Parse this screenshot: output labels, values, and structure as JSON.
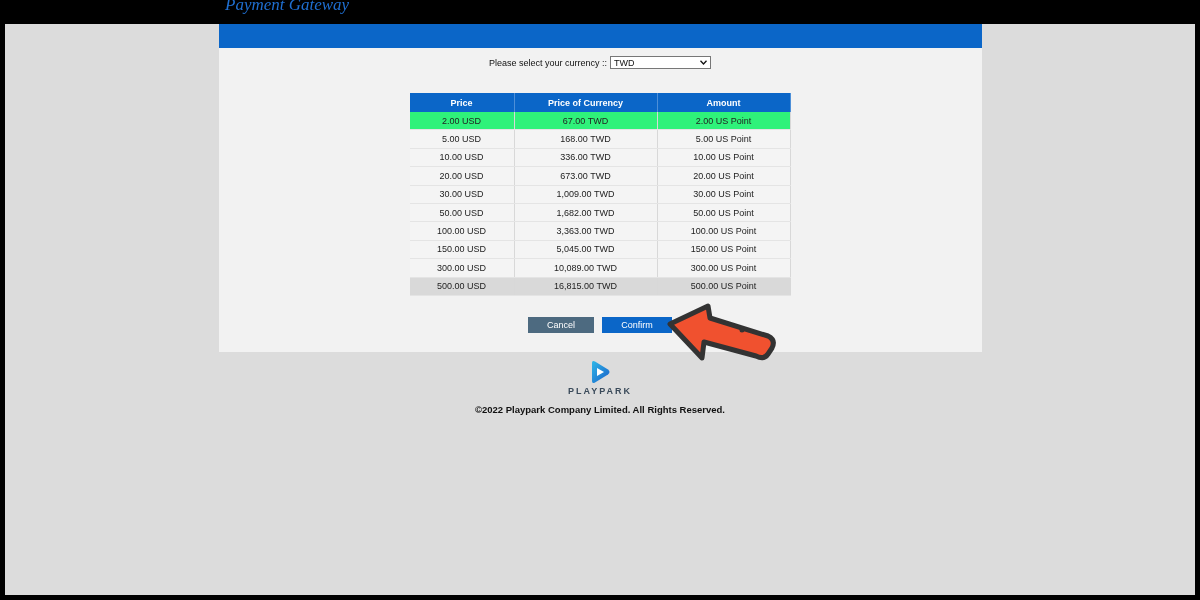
{
  "page_title": "Payment Gateway",
  "currency_select": {
    "label": "Please select your currency ::",
    "value": "TWD"
  },
  "table": {
    "columns": [
      "Price",
      "Price of Currency",
      "Amount"
    ],
    "rows": [
      {
        "cells": [
          "2.00 USD",
          "67.00 TWD",
          "2.00 US Point"
        ],
        "selected": true,
        "hovered": false
      },
      {
        "cells": [
          "5.00 USD",
          "168.00 TWD",
          "5.00 US Point"
        ],
        "selected": false,
        "hovered": false
      },
      {
        "cells": [
          "10.00 USD",
          "336.00 TWD",
          "10.00 US Point"
        ],
        "selected": false,
        "hovered": false
      },
      {
        "cells": [
          "20.00 USD",
          "673.00 TWD",
          "20.00 US Point"
        ],
        "selected": false,
        "hovered": false
      },
      {
        "cells": [
          "30.00 USD",
          "1,009.00 TWD",
          "30.00 US Point"
        ],
        "selected": false,
        "hovered": false
      },
      {
        "cells": [
          "50.00 USD",
          "1,682.00 TWD",
          "50.00 US Point"
        ],
        "selected": false,
        "hovered": false
      },
      {
        "cells": [
          "100.00 USD",
          "3,363.00 TWD",
          "100.00 US Point"
        ],
        "selected": false,
        "hovered": false
      },
      {
        "cells": [
          "150.00 USD",
          "5,045.00 TWD",
          "150.00 US Point"
        ],
        "selected": false,
        "hovered": false
      },
      {
        "cells": [
          "300.00 USD",
          "10,089.00 TWD",
          "300.00 US Point"
        ],
        "selected": false,
        "hovered": false
      },
      {
        "cells": [
          "500.00 USD",
          "16,815.00 TWD",
          "500.00 US Point"
        ],
        "selected": false,
        "hovered": true
      }
    ]
  },
  "buttons": [
    {
      "label": "Cancel",
      "kind": "secondary"
    },
    {
      "label": "Confirm",
      "kind": "primary"
    }
  ],
  "footer": {
    "logo_text": "PLAYPARK",
    "copyright": "©2022 Playpark Company Limited. All Rights Reserved."
  }
}
